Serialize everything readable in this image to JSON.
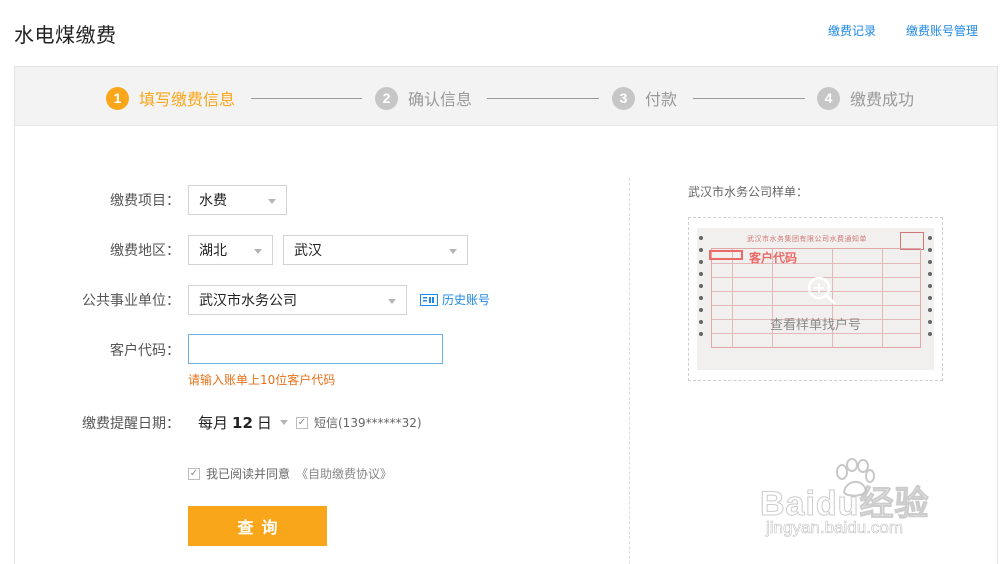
{
  "page": {
    "title": "水电煤缴费"
  },
  "top_links": {
    "records": "缴费记录",
    "accounts": "缴费账号管理"
  },
  "steps": [
    {
      "num": "1",
      "label": "填写缴费信息",
      "active": true
    },
    {
      "num": "2",
      "label": "确认信息",
      "active": false
    },
    {
      "num": "3",
      "label": "付款",
      "active": false
    },
    {
      "num": "4",
      "label": "缴费成功",
      "active": false
    }
  ],
  "form": {
    "item_label": "缴费项目：",
    "item_value": "水费",
    "region_label": "缴费地区：",
    "province_value": "湖北",
    "city_value": "武汉",
    "company_label": "公共事业单位：",
    "company_value": "武汉市水务公司",
    "history_link": "历史账号",
    "customer_label": "客户代码：",
    "customer_value": "",
    "customer_hint": "请输入账单上10位客户代码",
    "reminder_label": "缴费提醒日期：",
    "reminder_prefix": "每月",
    "reminder_day": "12",
    "reminder_suffix": "日",
    "sms_label": "短信(139******32)",
    "agree_text": "我已阅读并同意",
    "agree_link": "《自助缴费协议》",
    "query_button": "查询"
  },
  "sample": {
    "title": "武汉市水务公司样单：",
    "receipt_header": "武汉市水务集团有限公司水费通知单",
    "receipt_code_label": "客户代码",
    "zoom_text": "查看样单找户号"
  },
  "watermark": {
    "brand": "Baidu经验",
    "url": "jingyan.baidu.com"
  },
  "colors": {
    "accent": "#f9a61b",
    "link": "#1e88e5",
    "hint": "#e8711a",
    "input_border": "#6fb2e6"
  }
}
